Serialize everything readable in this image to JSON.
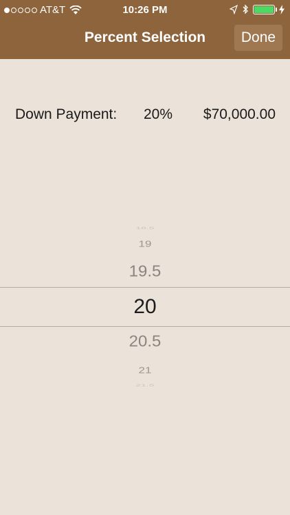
{
  "status_bar": {
    "signal_dots": [
      true,
      false,
      false,
      false,
      false
    ],
    "carrier": "AT&T",
    "time": "10:26 PM",
    "battery_level": 1.0,
    "battery_color": "#4cd964"
  },
  "nav": {
    "title": "Percent Selection",
    "done_label": "Done"
  },
  "summary": {
    "label": "Down Payment:",
    "percent": "20%",
    "amount": "$70,000.00"
  },
  "picker": {
    "items": [
      "18.5",
      "19",
      "19.5",
      "20",
      "20.5",
      "21",
      "21.5"
    ],
    "selected": "20"
  },
  "colors": {
    "header": "#8e643d",
    "background": "#ebe2d9",
    "done_button": "#9f7750"
  }
}
